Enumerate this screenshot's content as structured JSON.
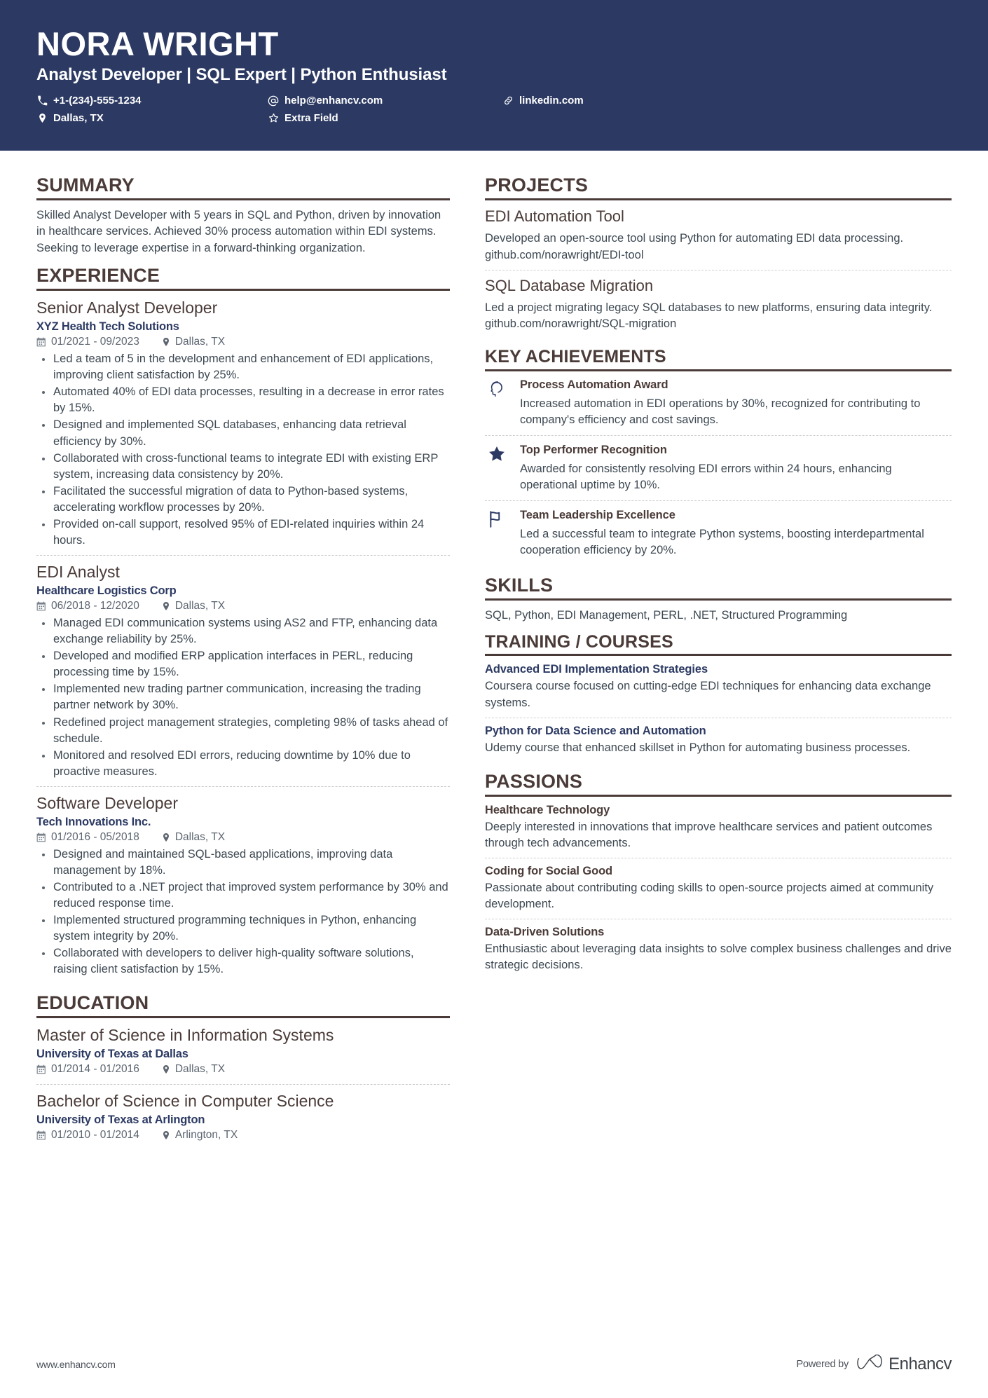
{
  "colors": {
    "header_bg": "#2c3a63",
    "section_heading": "#4a3b38",
    "accent_navy": "#2c3a63",
    "body_text": "#3d4852"
  },
  "header": {
    "name": "NORA WRIGHT",
    "headline": "Analyst Developer | SQL Expert | Python Enthusiast",
    "contacts": [
      {
        "icon": "phone-icon",
        "text": "+1-(234)-555-1234",
        "col": 1
      },
      {
        "icon": "map-pin-icon",
        "text": "Dallas, TX",
        "col": 1
      },
      {
        "icon": "at-sign-icon",
        "text": "help@enhancv.com",
        "col": 2
      },
      {
        "icon": "star-outline-icon",
        "text": "Extra Field",
        "col": 2
      },
      {
        "icon": "link-icon",
        "text": "linkedin.com",
        "col": 3
      }
    ]
  },
  "left": {
    "summary": {
      "heading": "SUMMARY",
      "text": "Skilled Analyst Developer with 5 years in SQL and Python, driven by innovation in healthcare services. Achieved 30% process automation within EDI systems. Seeking to leverage expertise in a forward-thinking organization."
    },
    "experience": {
      "heading": "EXPERIENCE",
      "entries": [
        {
          "title": "Senior Analyst Developer",
          "org": "XYZ Health Tech Solutions",
          "dates": "01/2021 - 09/2023",
          "location": "Dallas, TX",
          "bullets": [
            "Led a team of 5 in the development and enhancement of EDI applications, improving client satisfaction by 25%.",
            "Automated 40% of EDI data processes, resulting in a decrease in error rates by 15%.",
            "Designed and implemented SQL databases, enhancing data retrieval efficiency by 30%.",
            "Collaborated with cross-functional teams to integrate EDI with existing ERP system, increasing data consistency by 20%.",
            "Facilitated the successful migration of data to Python-based systems, accelerating workflow processes by 20%.",
            "Provided on-call support, resolved 95% of EDI-related inquiries within 24 hours."
          ]
        },
        {
          "title": "EDI Analyst",
          "org": "Healthcare Logistics Corp",
          "dates": "06/2018 - 12/2020",
          "location": "Dallas, TX",
          "bullets": [
            "Managed EDI communication systems using AS2 and FTP, enhancing data exchange reliability by 25%.",
            "Developed and modified ERP application interfaces in PERL, reducing processing time by 15%.",
            "Implemented new trading partner communication, increasing the trading partner network by 30%.",
            "Redefined project management strategies, completing 98% of tasks ahead of schedule.",
            "Monitored and resolved EDI errors, reducing downtime by 10% due to proactive measures."
          ]
        },
        {
          "title": "Software Developer",
          "org": "Tech Innovations Inc.",
          "dates": "01/2016 - 05/2018",
          "location": "Dallas, TX",
          "bullets": [
            "Designed and maintained SQL-based applications, improving data management by 18%.",
            "Contributed to a .NET project that improved system performance by 30% and reduced response time.",
            "Implemented structured programming techniques in Python, enhancing system integrity by 20%.",
            "Collaborated with developers to deliver high-quality software solutions, raising client satisfaction by 15%."
          ]
        }
      ]
    },
    "education": {
      "heading": "EDUCATION",
      "entries": [
        {
          "title": "Master of Science in Information Systems",
          "org": "University of Texas at Dallas",
          "dates": "01/2014 - 01/2016",
          "location": "Dallas, TX"
        },
        {
          "title": "Bachelor of Science in Computer Science",
          "org": "University of Texas at Arlington",
          "dates": "01/2010 - 01/2014",
          "location": "Arlington, TX"
        }
      ]
    }
  },
  "right": {
    "projects": {
      "heading": "PROJECTS",
      "items": [
        {
          "title": "EDI Automation Tool",
          "text": "Developed an open-source tool using Python for automating EDI data processing.\ngithub.com/norawright/EDI-tool"
        },
        {
          "title": "SQL Database Migration",
          "text": "Led a project migrating legacy SQL databases to new platforms, ensuring data integrity.\ngithub.com/norawright/SQL-migration"
        }
      ]
    },
    "achievements": {
      "heading": "KEY ACHIEVEMENTS",
      "items": [
        {
          "icon": "head-profile-icon",
          "title": "Process Automation Award",
          "text": "Increased automation in EDI operations by 30%, recognized for contributing to company's efficiency and cost savings."
        },
        {
          "icon": "star-icon",
          "title": "Top Performer Recognition",
          "text": "Awarded for consistently resolving EDI errors within 24 hours, enhancing operational uptime by 10%."
        },
        {
          "icon": "flag-icon",
          "title": "Team Leadership Excellence",
          "text": "Led a successful team to integrate Python systems, boosting interdepartmental cooperation efficiency by 20%."
        }
      ]
    },
    "skills": {
      "heading": "SKILLS",
      "text": "SQL, Python, EDI Management, PERL, .NET, Structured Programming"
    },
    "training": {
      "heading": "TRAINING / COURSES",
      "items": [
        {
          "title": "Advanced EDI Implementation Strategies",
          "text": "Coursera course focused on cutting-edge EDI techniques for enhancing data exchange systems."
        },
        {
          "title": "Python for Data Science and Automation",
          "text": "Udemy course that enhanced skillset in Python for automating business processes."
        }
      ]
    },
    "passions": {
      "heading": "PASSIONS",
      "items": [
        {
          "title": "Healthcare Technology",
          "text": "Deeply interested in innovations that improve healthcare services and patient outcomes through tech advancements."
        },
        {
          "title": "Coding for Social Good",
          "text": "Passionate about contributing coding skills to open-source projects aimed at community development."
        },
        {
          "title": "Data-Driven Solutions",
          "text": "Enthusiastic about leveraging data insights to solve complex business challenges and drive strategic decisions."
        }
      ]
    }
  },
  "footer": {
    "website": "www.enhancv.com",
    "powered_by": "Powered by",
    "brand": "Enhancv"
  }
}
